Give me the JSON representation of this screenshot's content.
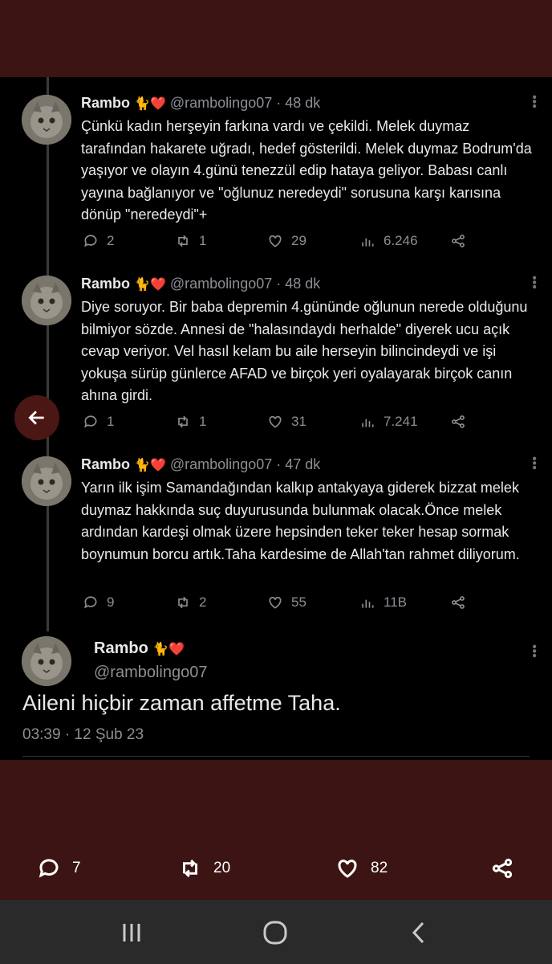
{
  "thread": [
    {
      "name": "Rambo",
      "emoji": "🐈❤️",
      "meta": "@rambolingo07 · 48 dk",
      "text": "Çünkü kadın herşeyin farkına vardı ve çekildi. Melek duymaz tarafından hakarete uğradı, hedef gösterildi. Melek duymaz Bodrum'da yaşıyor ve olayın 4.günü tenezzül edip hataya geliyor. Babası canlı yayına bağlanıyor ve \"oğlunuz neredeydi\" sorusuna karşı karısına dönüp \"neredeydi\"+",
      "replies": "2",
      "retweets": "1",
      "likes": "29",
      "views": "6.246"
    },
    {
      "name": "Rambo",
      "emoji": "🐈❤️",
      "meta": "@rambolingo07 · 48 dk",
      "text": "Diye soruyor. Bir baba depremin 4.gününde oğlunun nerede olduğunu bilmiyor sözde. Annesi de \"halasındaydı herhalde\" diyerek ucu açık cevap veriyor. Vel hasıl kelam bu aile herseyin bilincindeydi ve işi yokuşa sürüp günlerce AFAD ve birçok yeri oyalayarak birçok canın ahına girdi.",
      "replies": "1",
      "retweets": "1",
      "likes": "31",
      "views": "7.241"
    },
    {
      "name": "Rambo",
      "emoji": "🐈❤️",
      "meta": "@rambolingo07 · 47 dk",
      "text": "Yarın ilk işim Samandağından kalkıp antakyaya giderek bizzat melek duymaz hakkında suç duyurusunda bulunmak olacak.Önce melek ardından kardeşi olmak üzere hepsinden teker teker hesap sormak boynumun borcu artık.Taha kardesime de Allah'tan rahmet diliyorum.",
      "replies": "9",
      "retweets": "2",
      "likes": "55",
      "views": "11B"
    }
  ],
  "main_tweet": {
    "name": "Rambo",
    "emoji": "🐈❤️",
    "handle": "@rambolingo07",
    "text": "Aileni hiçbir zaman affetme Taha.",
    "timestamp": "03:39 · 12 Şub 23"
  },
  "bottom_bar": {
    "replies": "7",
    "retweets": "20",
    "likes": "82"
  },
  "icons": [
    "back-arrow-icon",
    "reply-icon",
    "retweet-icon",
    "like-icon",
    "views-icon",
    "share-icon",
    "more-icon",
    "recents-icon",
    "home-icon",
    "back-chevron-icon"
  ],
  "colors": {
    "background": "#3b1413",
    "tweet_bg": "#000000",
    "text": "#e7e9ea",
    "muted": "#8b8f94"
  }
}
